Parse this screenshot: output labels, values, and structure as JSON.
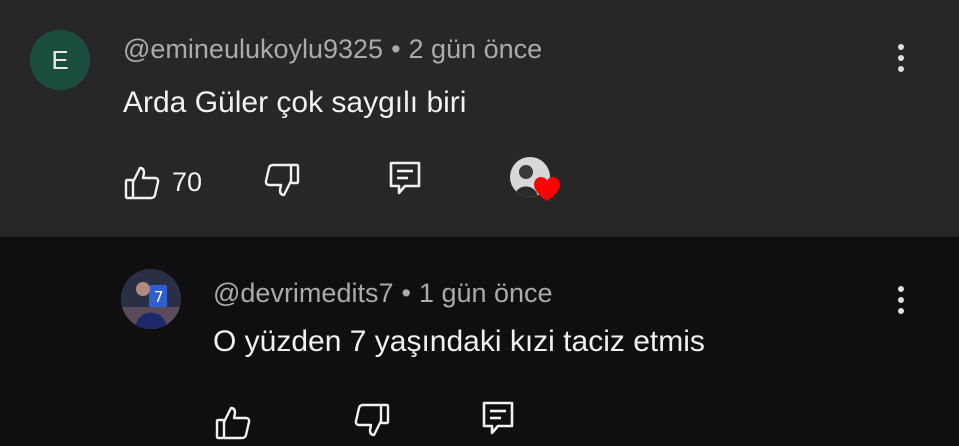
{
  "comments": [
    {
      "avatar_letter": "E",
      "handle": "@emineulukoylu9325",
      "separator": "•",
      "time": "2 gün önce",
      "text": "Arda Güler çok saygılı biri",
      "like_count": "70",
      "icons": {
        "like": "thumbs-up-icon",
        "dislike": "thumbs-down-icon",
        "reply": "reply-icon",
        "menu": "more-vert-icon",
        "creator_heart": "creator-heart-icon"
      }
    },
    {
      "handle": "@devrimedits7",
      "separator": "•",
      "time": "1 gün önce",
      "text": "O yüzden 7 yaşındaki kızi taciz etmis",
      "icons": {
        "like": "thumbs-up-icon",
        "dislike": "thumbs-down-icon",
        "reply": "reply-icon",
        "menu": "more-vert-icon"
      }
    }
  ],
  "colors": {
    "top_comment_bg": "#272727",
    "reply_bg": "#0f0f0f",
    "meta_text": "#aaaaaa",
    "body_text": "#f1f1f1",
    "avatar_bg": "#1b4d3e",
    "heart": "#ff0000"
  }
}
